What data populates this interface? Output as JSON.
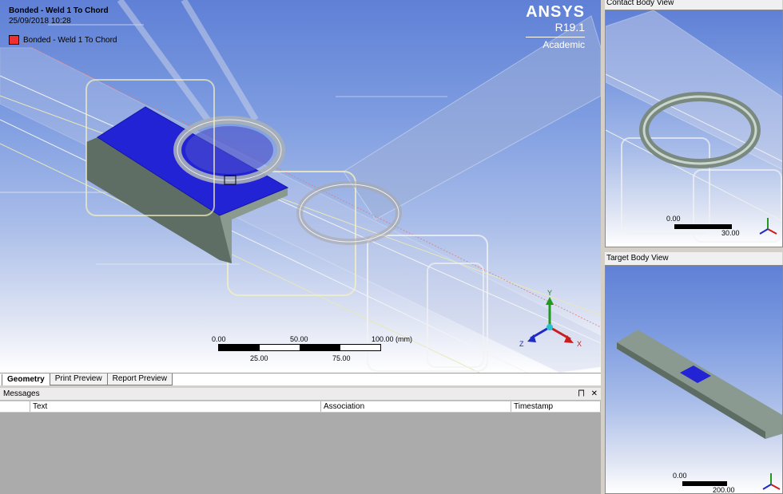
{
  "main_view": {
    "title": "Bonded - Weld 1 To Chord",
    "date": "25/09/2018 10:28",
    "legend_label": "Bonded - Weld 1 To Chord",
    "legend_color": "#ee3030",
    "logo": {
      "name": "ANSYS",
      "version": "R19.1",
      "edition": "Academic"
    },
    "scalebar": {
      "t0": "0.00",
      "t1": "50.00",
      "t2": "100.00 (mm)",
      "t3": "25.00",
      "t4": "75.00"
    },
    "axes": {
      "x": "X",
      "y": "Y",
      "z": "Z"
    },
    "highlight_color": "#2323d6"
  },
  "tabs": [
    {
      "label": "Geometry"
    },
    {
      "label": "Print Preview"
    },
    {
      "label": "Report Preview"
    }
  ],
  "messages": {
    "title": "Messages",
    "pin_icon": "⨅",
    "close_icon": "✕",
    "columns": [
      "",
      "Text",
      "Association",
      "Timestamp"
    ]
  },
  "contact_view": {
    "title": "Contact Body View",
    "scale_0": "0.00",
    "scale_1": "30.00"
  },
  "target_view": {
    "title": "Target Body View",
    "scale_0": "0.00",
    "scale_1": "200.00"
  }
}
